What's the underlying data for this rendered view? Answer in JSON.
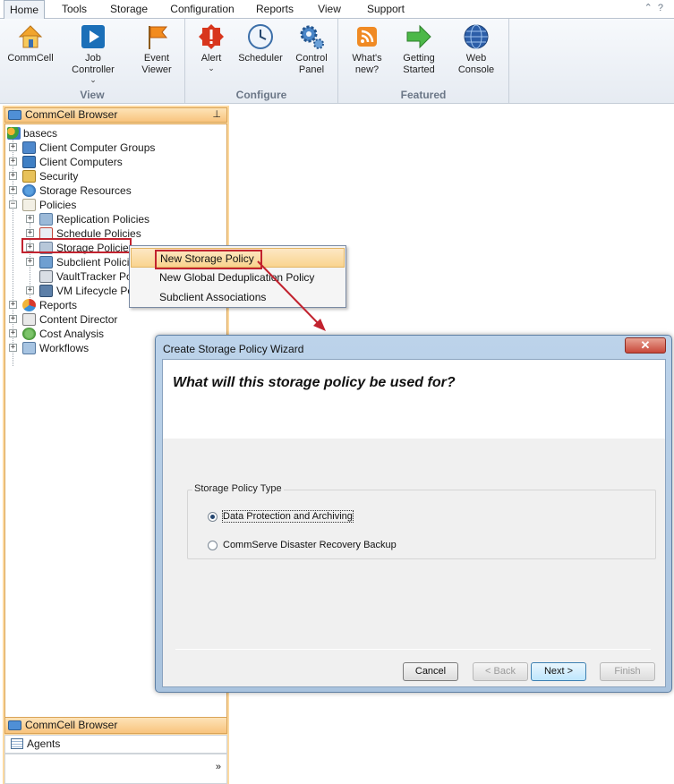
{
  "ribbon": {
    "tabs": [
      "Home",
      "Tools",
      "Storage",
      "Configuration",
      "Reports",
      "View",
      "Support"
    ],
    "groups": {
      "view": {
        "label": "View",
        "buttons": [
          "CommCell",
          "Job\nController",
          "Event\nViewer"
        ]
      },
      "configure": {
        "label": "Configure",
        "buttons": [
          "Alert",
          "Scheduler",
          "Control\nPanel"
        ]
      },
      "featured": {
        "label": "Featured",
        "buttons": [
          "What's\nnew?",
          "Getting\nStarted",
          "Web\nConsole"
        ]
      }
    }
  },
  "browser": {
    "title": "CommCell Browser",
    "pin_icon": "pin-icon",
    "tree": [
      "basecs",
      "Client Computer Groups",
      "Client Computers",
      "Security",
      "Storage Resources",
      "Policies",
      "Replication Policies",
      "Schedule Policies",
      "Storage Policies",
      "Subclient Policies",
      "VaultTracker Policies",
      "VM Lifecycle Policies",
      "Reports",
      "Content Director",
      "Cost Analysis",
      "Workflows"
    ],
    "nav": [
      "CommCell Browser",
      "Agents"
    ]
  },
  "context_menu": {
    "items": [
      "New Storage Policy",
      "New Global Deduplication Policy",
      "Subclient Associations"
    ]
  },
  "wizard": {
    "title": "Create Storage Policy Wizard",
    "close_icon": "close-icon",
    "question": "What will this storage policy be used for?",
    "group_label": "Storage Policy Type",
    "options": [
      "Data Protection and Archiving",
      "CommServe Disaster Recovery Backup"
    ],
    "selected_option": "Data Protection and Archiving",
    "buttons": {
      "cancel": "Cancel",
      "back": "< Back",
      "next": "Next >",
      "finish": "Finish"
    }
  },
  "colors": {
    "highlight_red": "#c2232f",
    "panel_orange": "#f8c47e",
    "dialog_blue": "#a9c3de"
  }
}
